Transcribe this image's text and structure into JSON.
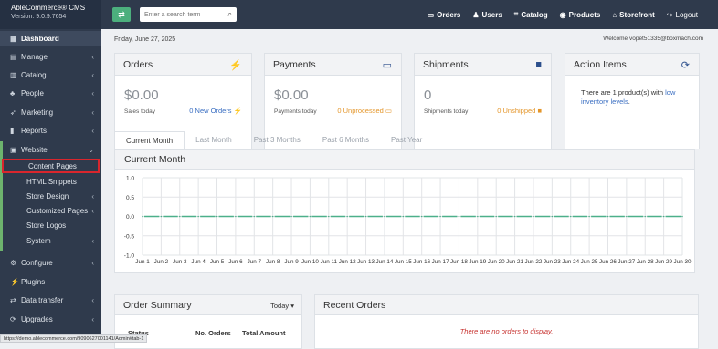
{
  "app": {
    "name": "AbleCommerce® CMS",
    "version": "Version: 9.0.9.7654"
  },
  "sidebar": {
    "items": [
      {
        "label": "Dashboard",
        "icon": "dashboard-icon",
        "glyph": "▦",
        "chev": ""
      },
      {
        "label": "Manage",
        "icon": "manage-icon",
        "glyph": "▤",
        "chev": "‹"
      },
      {
        "label": "Catalog",
        "icon": "catalog-icon",
        "glyph": "▥",
        "chev": "‹"
      },
      {
        "label": "People",
        "icon": "people-icon",
        "glyph": "♣",
        "chev": "‹"
      },
      {
        "label": "Marketing",
        "icon": "marketing-icon",
        "glyph": "➶",
        "chev": "‹"
      },
      {
        "label": "Reports",
        "icon": "reports-icon",
        "glyph": "▮",
        "chev": "‹"
      },
      {
        "label": "Website",
        "icon": "website-icon",
        "glyph": "▣",
        "chev": "⌄"
      }
    ],
    "website_sub": [
      {
        "label": "Content Pages",
        "chev": ""
      },
      {
        "label": "HTML Snippets",
        "chev": ""
      },
      {
        "label": "Store Design",
        "chev": "‹"
      },
      {
        "label": "Customized Pages",
        "chev": "‹"
      },
      {
        "label": "Store Logos",
        "chev": ""
      },
      {
        "label": "System",
        "chev": "‹"
      }
    ],
    "lower_items": [
      {
        "label": "Configure",
        "icon": "configure-icon",
        "glyph": "⚙",
        "chev": "‹"
      },
      {
        "label": "Plugins",
        "icon": "plugins-icon",
        "glyph": "⚡",
        "chev": ""
      },
      {
        "label": "Data transfer",
        "icon": "data-transfer-icon",
        "glyph": "⇄",
        "chev": "‹"
      },
      {
        "label": "Upgrades",
        "icon": "upgrades-icon",
        "glyph": "⟳",
        "chev": "‹"
      }
    ]
  },
  "topbar": {
    "toggle_glyph": "⇄",
    "search_placeholder": "Enter a search term",
    "links": [
      {
        "label": "Orders",
        "icon": "orders-icon",
        "glyph": "▭"
      },
      {
        "label": "Users",
        "icon": "users-icon",
        "glyph": "♟"
      },
      {
        "label": "Catalog",
        "icon": "catalog-tree-icon",
        "glyph": "⌗"
      },
      {
        "label": "Products",
        "icon": "products-icon",
        "glyph": "◉"
      },
      {
        "label": "Storefront",
        "icon": "storefront-icon",
        "glyph": "⌂"
      },
      {
        "label": "Logout",
        "icon": "logout-icon",
        "glyph": "↪"
      }
    ]
  },
  "header": {
    "date": "Friday, June 27, 2025",
    "welcome": "Welcome vopet51335@boxmach.com"
  },
  "cards": {
    "orders": {
      "title": "Orders",
      "value": "$0.00",
      "sub": "Sales today",
      "link": "0 New Orders",
      "link_glyph": "⚡",
      "icon_glyph": "⚡"
    },
    "payments": {
      "title": "Payments",
      "value": "$0.00",
      "sub": "Payments today",
      "link": "0 Unprocessed",
      "link_glyph": "▭",
      "icon_glyph": "▭"
    },
    "shipments": {
      "title": "Shipments",
      "value": "0",
      "sub": "Shipments today",
      "link": "0 Unshipped",
      "link_glyph": "■",
      "icon_glyph": "■"
    },
    "action": {
      "title": "Action Items",
      "text_pre": "There are 1 product(s) with ",
      "text_link": "low inventory levels",
      "text_post": ".",
      "icon_glyph": "⟳"
    }
  },
  "tabs": [
    "Current Month",
    "Last Month",
    "Past 3 Months",
    "Past 6 Months",
    "Past Year"
  ],
  "chart_panel_title": "Current Month",
  "chart_data": {
    "type": "line",
    "title": "",
    "x": [
      "Jun 1",
      "Jun 2",
      "Jun 3",
      "Jun 4",
      "Jun 5",
      "Jun 6",
      "Jun 7",
      "Jun 8",
      "Jun 9",
      "Jun 10",
      "Jun 11",
      "Jun 12",
      "Jun 13",
      "Jun 14",
      "Jun 15",
      "Jun 16",
      "Jun 17",
      "Jun 18",
      "Jun 19",
      "Jun 20",
      "Jun 21",
      "Jun 22",
      "Jun 23",
      "Jun 24",
      "Jun 25",
      "Jun 26",
      "Jun 27",
      "Jun 28",
      "Jun 29",
      "Jun 30"
    ],
    "series": [
      {
        "values": [
          0,
          0,
          0,
          0,
          0,
          0,
          0,
          0,
          0,
          0,
          0,
          0,
          0,
          0,
          0,
          0,
          0,
          0,
          0,
          0,
          0,
          0,
          0,
          0,
          0,
          0,
          0,
          0,
          0,
          0
        ],
        "color": "#4cb08a"
      }
    ],
    "yticks": [
      "1.0",
      "0.5",
      "0.0",
      "-0.5",
      "-1.0"
    ],
    "ylim": [
      -1,
      1
    ],
    "grid": true,
    "line_style": "dashed"
  },
  "order_summary": {
    "title": "Order Summary",
    "period": "Today ▾",
    "columns": [
      "Status",
      "No. Orders",
      "Total Amount"
    ]
  },
  "recent_orders": {
    "title": "Recent Orders",
    "empty": "There are no orders to display."
  },
  "status_url": "https://demo.ablecommerce.com/9090627001141/Admin#tab-1",
  "colors": {
    "sidebar": "#2f3a4c",
    "accent_green": "#4caf7d",
    "highlight": "#d9262d",
    "link_blue": "#3b6fc2",
    "warn_orange": "#e4962a"
  }
}
